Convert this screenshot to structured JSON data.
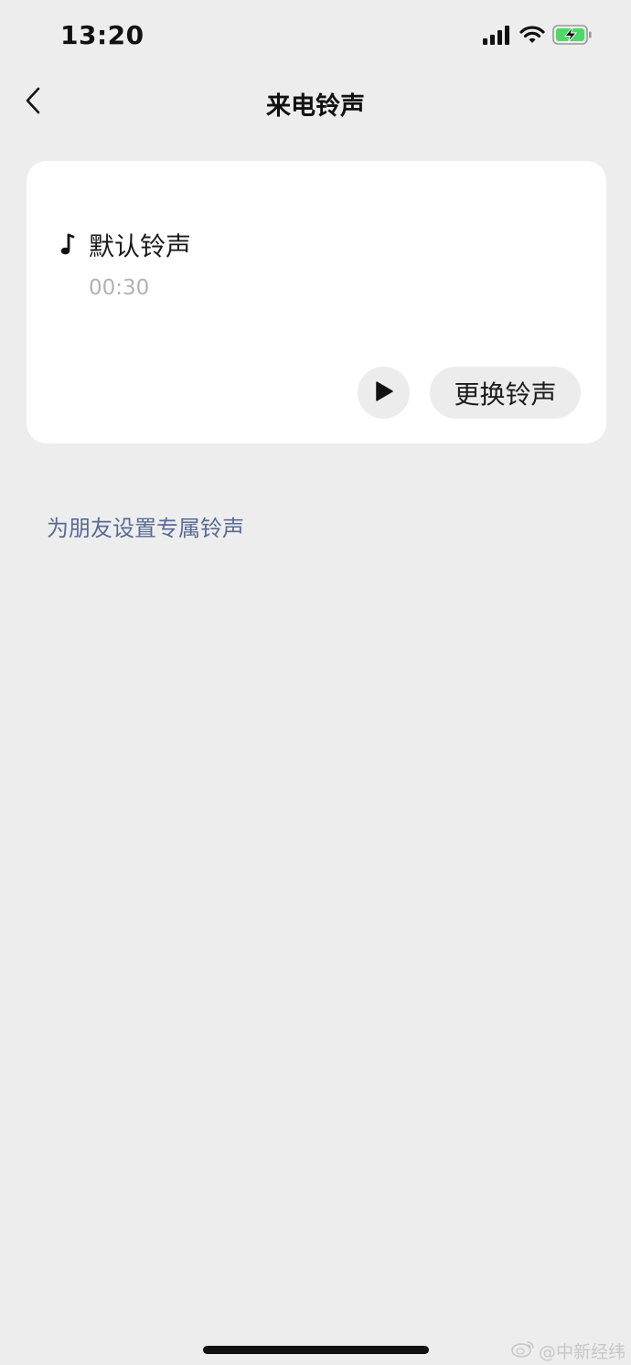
{
  "status_bar": {
    "time": "13:20",
    "battery_color": "#4cd964"
  },
  "nav": {
    "title": "来电铃声"
  },
  "ringtone": {
    "name": "默认铃声",
    "duration": "00:30",
    "change_label": "更换铃声"
  },
  "friend_link": "为朋友设置专属铃声",
  "watermark": {
    "text": "@中新经纬",
    "logo_icon": "weibo-logo-icon"
  },
  "colors": {
    "background": "#ededed",
    "card": "#ffffff",
    "link": "#576b95",
    "secondary_text": "#b2b2b2"
  }
}
